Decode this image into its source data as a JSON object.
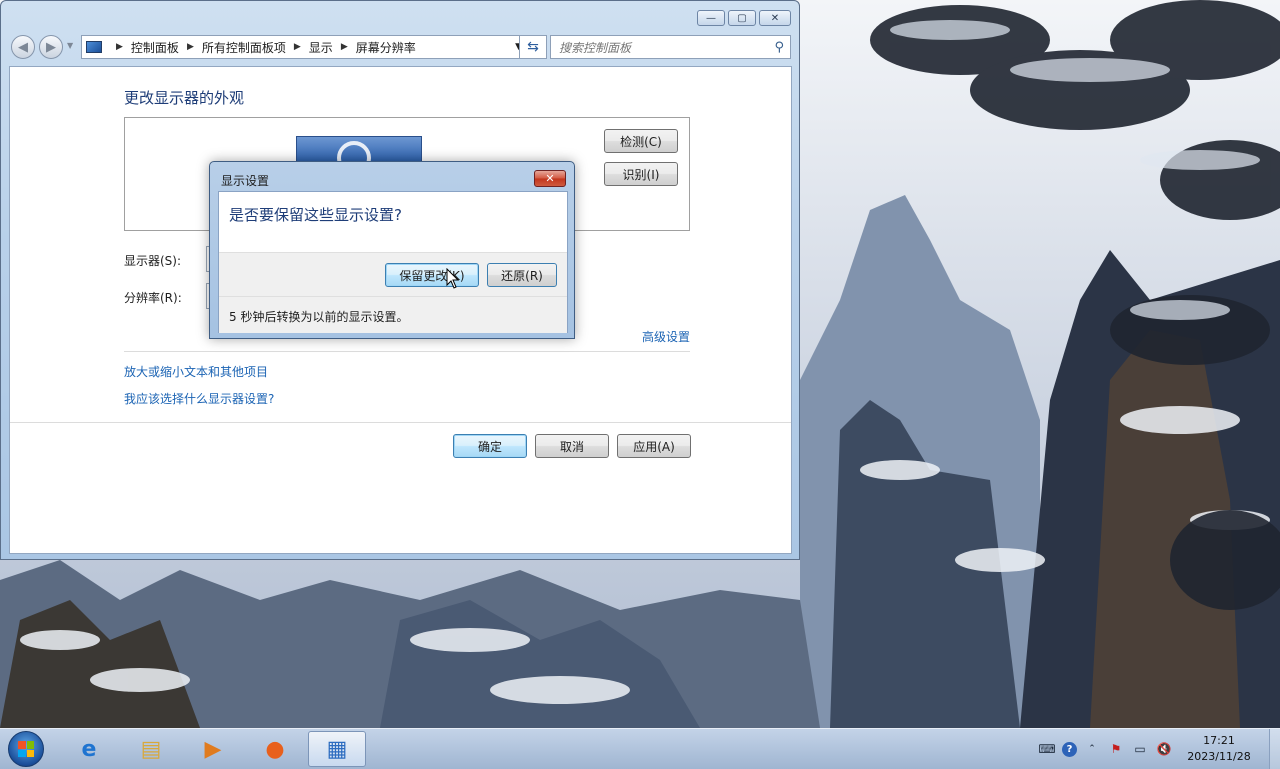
{
  "window": {
    "controls": {
      "minimize": "—",
      "maximize": "▢",
      "close": "✕"
    },
    "nav": {
      "back": "◀",
      "forward": "▶"
    },
    "breadcrumb": [
      "控制面板",
      "所有控制面板项",
      "显示",
      "屏幕分辨率"
    ],
    "search": {
      "placeholder": "搜索控制面板"
    }
  },
  "page": {
    "title": "更改显示器的外观",
    "detect_button": "检测(C)",
    "identify_button": "识别(I)",
    "display_label": "显示器(S):",
    "resolution_label": "分辨率(R):",
    "advanced_link": "高级设置",
    "links": [
      "放大或缩小文本和其他项目",
      "我应该选择什么显示器设置?"
    ],
    "ok_button": "确定",
    "cancel_button": "取消",
    "apply_button": "应用(A)"
  },
  "dialog": {
    "title": "显示设置",
    "question": "是否要保留这些显示设置?",
    "keep_button": "保留更改(K)",
    "revert_button": "还原(R)",
    "countdown_text": "5 秒钟后转换为以前的显示设置。"
  },
  "taskbar": {
    "apps": [
      {
        "name": "internet-explorer-icon",
        "glyph": "e",
        "color": "#1f74d0"
      },
      {
        "name": "file-explorer-icon",
        "glyph": "▤",
        "color": "#d8a83a"
      },
      {
        "name": "media-player-icon",
        "glyph": "▶",
        "color": "#e07b1e"
      },
      {
        "name": "firefox-icon",
        "glyph": "●",
        "color": "#e8601c"
      },
      {
        "name": "control-panel-icon",
        "glyph": "▦",
        "color": "#2c6cc0"
      }
    ],
    "clock": {
      "time": "17:21",
      "date": "2023/11/28"
    }
  }
}
